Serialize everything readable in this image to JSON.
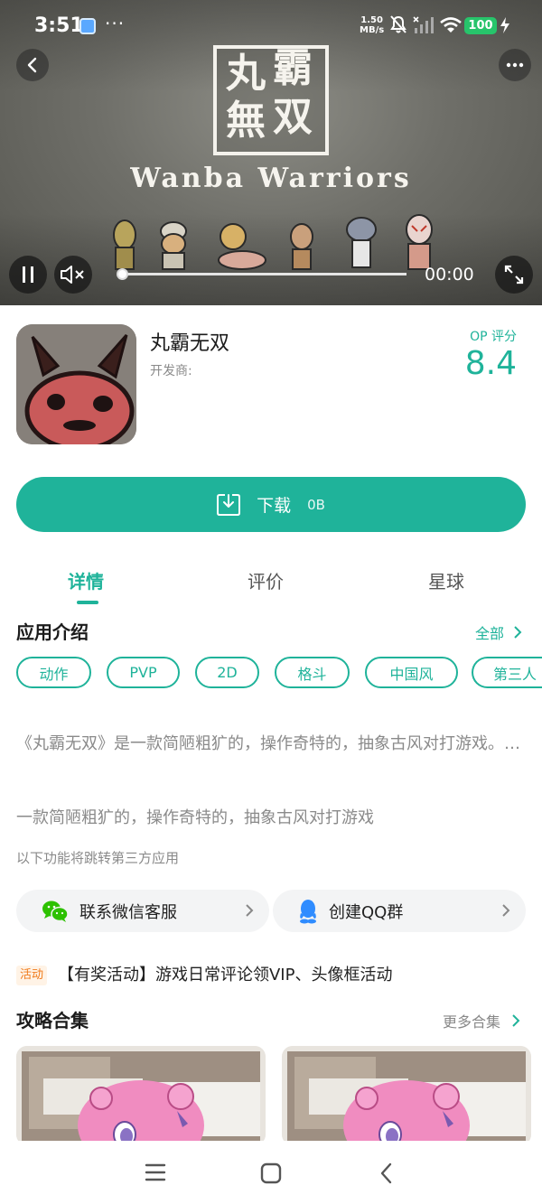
{
  "status_bar": {
    "time": "3:51",
    "speed_value": "1.50",
    "speed_unit": "MB/s",
    "battery": "100"
  },
  "hero": {
    "logo_chars": [
      "丸",
      "霸",
      "無",
      "双"
    ],
    "title_en": "Wanba Warriors",
    "time": "00:00",
    "progress": 0.0
  },
  "app": {
    "name": "丸霸无双",
    "developer": "开发商:",
    "score_label": "OP 评分",
    "score": "8.4"
  },
  "download": {
    "label": "下载",
    "size": "0B"
  },
  "tabs": [
    {
      "label": "详情",
      "active": true
    },
    {
      "label": "评价",
      "active": false
    },
    {
      "label": "星球",
      "active": false
    }
  ],
  "intro": {
    "title": "应用介绍",
    "all_link": "全部",
    "tags": [
      "动作",
      "PVP",
      "2D",
      "格斗",
      "中国风",
      "第三人"
    ],
    "description": "《丸霸无双》是一款简陋粗犷的，操作奇特的，抽象古风对打游戏。…",
    "summary": "一款简陋粗犷的，操作奇特的，抽象古风对打游戏",
    "note": "以下功能将跳转第三方应用"
  },
  "actions": [
    {
      "label": "联系微信客服",
      "icon": "wechat-icon"
    },
    {
      "label": "创建QQ群",
      "icon": "qq-icon"
    }
  ],
  "promo": {
    "badge": "活动",
    "text": "【有奖活动】游戏日常评论领VIP、头像框活动"
  },
  "guides": {
    "title": "攻略合集",
    "more_link": "更多合集"
  },
  "colors": {
    "accent": "#1fb39a",
    "battery": "#27c46b",
    "badge": "#f07a1a"
  }
}
